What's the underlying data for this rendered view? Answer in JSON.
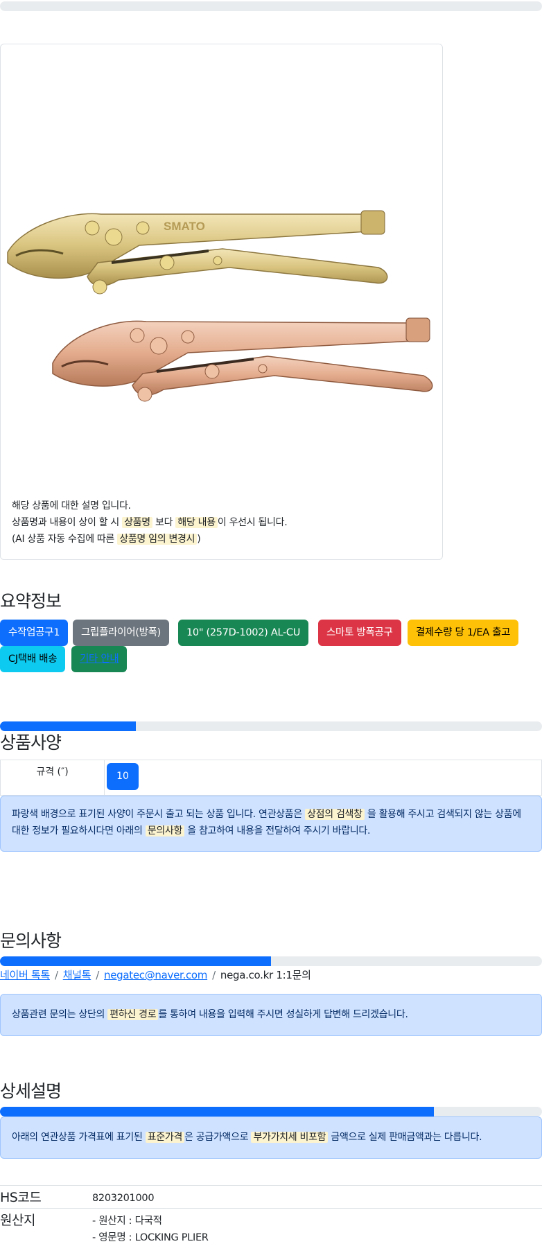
{
  "progress": {
    "top": 0,
    "spec": 0.25,
    "inquiry": 0.5,
    "detail": 0.8
  },
  "product": {
    "image_alt": "SMATO 방폭 그립플라이어",
    "logo_text": "SMATO",
    "desc_line1": "해당 상품에 대한 설명 입니다.",
    "desc_line2_a": "상품명과 내용이 상이 할 시 ",
    "desc_line2_mark1": "상품명",
    "desc_line2_b": " 보다 ",
    "desc_line2_mark2": "해당 내용",
    "desc_line2_c": "이 우선시 됩니다.",
    "desc_line3_a": "(AI 상품 자동 수집에 따른 ",
    "desc_line3_mark": "상품명 임의 변경시",
    "desc_line3_b": ")"
  },
  "summary": {
    "title": "요약정보",
    "badges": [
      {
        "label": "수작업공구1",
        "color": "#0d6efd"
      },
      {
        "label": "그립플라이어(방폭)",
        "color": "#6c757d"
      },
      {
        "label": "10\" (257D-1002) AL-CU",
        "color": "#198754"
      },
      {
        "label": "스마토 방폭공구",
        "color": "#dc3545"
      },
      {
        "label": "결제수량 당 1/EA 출고",
        "color": "#ffc107"
      },
      {
        "label": "CJ택배 배송",
        "color": "#0dcaf0"
      },
      {
        "label": "기타 안내",
        "color": "#198754"
      }
    ]
  },
  "spec": {
    "title": "상품사양",
    "label": "규격 (″)",
    "value": "10",
    "alert_a": "파랑색 배경으로 표기된 사양이 주문시 출고 되는 상품 입니다. 연관상품은 ",
    "alert_mark1": "상점의 검색창",
    "alert_b": " 을 활용해 주시고 검색되지 않는 상품에 대한 정보가 필요하시다면 아래의 ",
    "alert_mark2": "문의사항",
    "alert_c": " 을 참고하여 내용을 전달하여 주시기 바랍니다."
  },
  "inquiry": {
    "title": "문의사항",
    "link1": "네이버 톡톡",
    "link2": "채널톡",
    "link3": "negatec@naver.com",
    "text4": "nega.co.kr 1:1문의",
    "separator": "/",
    "alert_a": "상품관련 문의는 상단의 ",
    "alert_mark": "편하신 경로",
    "alert_b": "를 통하여 내용을 입력해 주시면 성실하게 답변해 드리겠습니다."
  },
  "detail": {
    "title": "상세설명",
    "alert_a": "아래의 연관상품 가격표에 표기된 ",
    "alert_mark1": "표준가격",
    "alert_b": "은 공급가액으로 ",
    "alert_mark2": "부가가치세 비포함",
    "alert_c": " 금액으로 실제 판매금액과는 다릅니다.",
    "rows": [
      {
        "key": "HS코드",
        "value": "8203201000"
      },
      {
        "key": "원산지",
        "value1": "- 원산지 : 다국적",
        "value2": "- 영문명 : LOCKING PLIER"
      }
    ]
  }
}
